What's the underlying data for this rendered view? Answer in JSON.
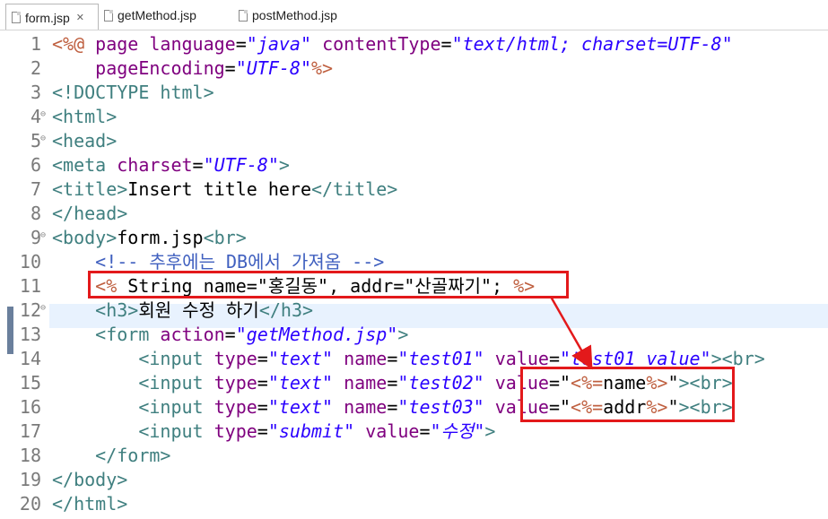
{
  "tabs": [
    {
      "label": "form.jsp",
      "close": "✕"
    },
    {
      "label": "getMethod.jsp"
    },
    {
      "label": "postMethod.jsp"
    }
  ],
  "lines": [
    {
      "n": "1",
      "segs": [
        [
          "j",
          "<%@ "
        ],
        [
          "a",
          "page "
        ],
        [
          "a",
          "language"
        ],
        [
          "t",
          "="
        ],
        [
          "v",
          "\"java\""
        ],
        [
          "t",
          " "
        ],
        [
          "a",
          "contentType"
        ],
        [
          "t",
          "="
        ],
        [
          "v",
          "\"text/html; charset=UTF-8\""
        ]
      ]
    },
    {
      "n": "2",
      "segs": [
        [
          "t",
          "    "
        ],
        [
          "a",
          "pageEncoding"
        ],
        [
          "t",
          "="
        ],
        [
          "v",
          "\"UTF-8\""
        ],
        [
          "j",
          "%>"
        ]
      ]
    },
    {
      "n": "3",
      "segs": [
        [
          "k",
          "<!DOCTYPE html>"
        ]
      ]
    },
    {
      "n": "4",
      "fold": "⊖",
      "segs": [
        [
          "k",
          "<html>"
        ]
      ]
    },
    {
      "n": "5",
      "fold": "⊖",
      "segs": [
        [
          "k",
          "<head>"
        ]
      ]
    },
    {
      "n": "6",
      "segs": [
        [
          "k",
          "<meta "
        ],
        [
          "a",
          "charset"
        ],
        [
          "t",
          "="
        ],
        [
          "v",
          "\"UTF-8\""
        ],
        [
          "k",
          ">"
        ]
      ]
    },
    {
      "n": "7",
      "segs": [
        [
          "k",
          "<title>"
        ],
        [
          "t",
          "Insert title here"
        ],
        [
          "k",
          "</title>"
        ]
      ]
    },
    {
      "n": "8",
      "segs": [
        [
          "k",
          "</head>"
        ]
      ]
    },
    {
      "n": "9",
      "fold": "⊖",
      "segs": [
        [
          "k",
          "<body>"
        ],
        [
          "t",
          "form.jsp"
        ],
        [
          "k",
          "<br>"
        ]
      ]
    },
    {
      "n": "10",
      "segs": [
        [
          "t",
          "    "
        ],
        [
          "c",
          "<!-- 추후에는 DB에서 가져옴 -->"
        ]
      ]
    },
    {
      "n": "11",
      "segs": [
        [
          "t",
          "    "
        ],
        [
          "j",
          "<%"
        ],
        [
          "t",
          " String name=\"홍길동\", addr=\"산골짜기\"; "
        ],
        [
          "j",
          "%>"
        ]
      ]
    },
    {
      "n": "12",
      "fold": "⊖",
      "segs": [
        [
          "t",
          "    "
        ],
        [
          "k",
          "<h3>"
        ],
        [
          "t",
          "회원 수정 하기"
        ],
        [
          "k",
          "</h3>"
        ]
      ]
    },
    {
      "n": "13",
      "segs": [
        [
          "t",
          "    "
        ],
        [
          "k",
          "<form "
        ],
        [
          "a",
          "action"
        ],
        [
          "t",
          "="
        ],
        [
          "v",
          "\"getMethod.jsp\""
        ],
        [
          "k",
          ">"
        ]
      ]
    },
    {
      "n": "14",
      "segs": [
        [
          "t",
          "        "
        ],
        [
          "k",
          "<input "
        ],
        [
          "a",
          "type"
        ],
        [
          "t",
          "="
        ],
        [
          "v",
          "\"text\""
        ],
        [
          "t",
          " "
        ],
        [
          "a",
          "name"
        ],
        [
          "t",
          "="
        ],
        [
          "v",
          "\"test01\""
        ],
        [
          "t",
          " "
        ],
        [
          "a",
          "value"
        ],
        [
          "t",
          "="
        ],
        [
          "v",
          "\"test01 value\""
        ],
        [
          "k",
          "><br>"
        ]
      ]
    },
    {
      "n": "15",
      "segs": [
        [
          "t",
          "        "
        ],
        [
          "k",
          "<input "
        ],
        [
          "a",
          "type"
        ],
        [
          "t",
          "="
        ],
        [
          "v",
          "\"text\""
        ],
        [
          "t",
          " "
        ],
        [
          "a",
          "name"
        ],
        [
          "t",
          "="
        ],
        [
          "v",
          "\"test02\""
        ],
        [
          "t",
          " "
        ],
        [
          "a",
          "value"
        ],
        [
          "t",
          "=\""
        ],
        [
          "j",
          "<%="
        ],
        [
          "t",
          "name"
        ],
        [
          "j",
          "%>"
        ],
        [
          "t",
          "\""
        ],
        [
          "k",
          "><br>"
        ]
      ]
    },
    {
      "n": "16",
      "segs": [
        [
          "t",
          "        "
        ],
        [
          "k",
          "<input "
        ],
        [
          "a",
          "type"
        ],
        [
          "t",
          "="
        ],
        [
          "v",
          "\"text\""
        ],
        [
          "t",
          " "
        ],
        [
          "a",
          "name"
        ],
        [
          "t",
          "="
        ],
        [
          "v",
          "\"test03\""
        ],
        [
          "t",
          " "
        ],
        [
          "a",
          "value"
        ],
        [
          "t",
          "=\""
        ],
        [
          "j",
          "<%="
        ],
        [
          "t",
          "addr"
        ],
        [
          "j",
          "%>"
        ],
        [
          "t",
          "\""
        ],
        [
          "k",
          "><br>"
        ]
      ]
    },
    {
      "n": "17",
      "segs": [
        [
          "t",
          "        "
        ],
        [
          "k",
          "<input "
        ],
        [
          "a",
          "type"
        ],
        [
          "t",
          "="
        ],
        [
          "v",
          "\"submit\""
        ],
        [
          "t",
          " "
        ],
        [
          "a",
          "value"
        ],
        [
          "t",
          "="
        ],
        [
          "v",
          "\"수정\""
        ],
        [
          "k",
          ">"
        ]
      ]
    },
    {
      "n": "18",
      "segs": [
        [
          "t",
          "    "
        ],
        [
          "k",
          "</form>"
        ]
      ]
    },
    {
      "n": "19",
      "segs": [
        [
          "k",
          "</body>"
        ]
      ]
    },
    {
      "n": "20",
      "segs": [
        [
          "k",
          "</html>"
        ]
      ]
    }
  ],
  "annotation_color": "#e3191b"
}
